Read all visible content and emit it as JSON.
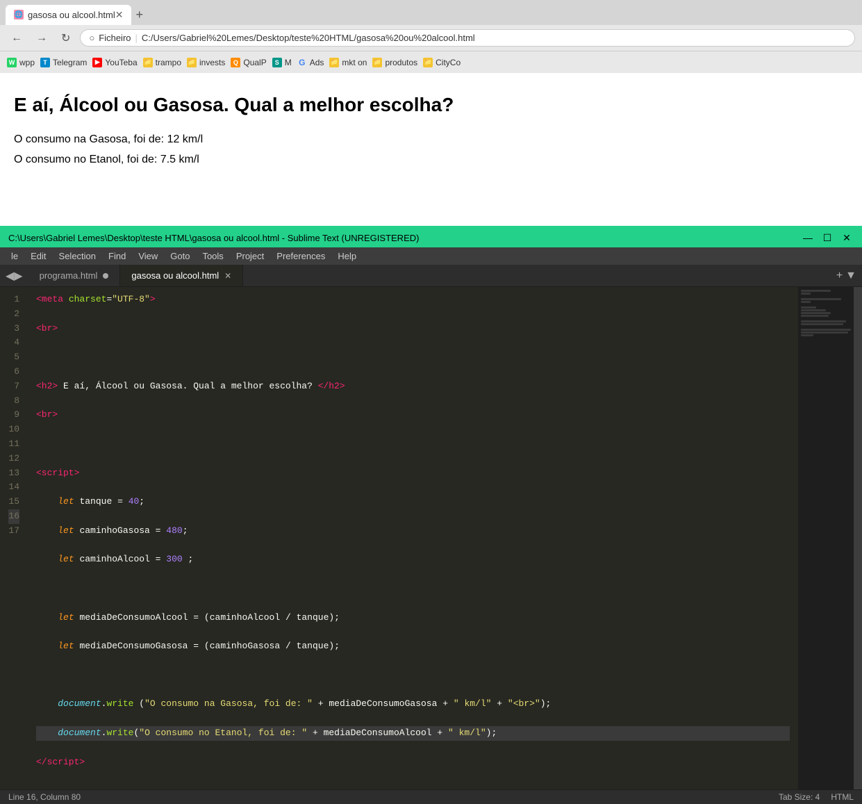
{
  "browser": {
    "tab": {
      "title": "gasosa ou alcool.html",
      "favicon": "🌐"
    },
    "address": {
      "protocol": "Ficheiro",
      "path": "C:/Users/Gabriel%20Lemes/Desktop/teste%20HTML/gasosa%20ou%20alcool.html"
    },
    "bookmarks": [
      {
        "label": "wpp",
        "icon": "W",
        "color": "bk-green"
      },
      {
        "label": "Telegram",
        "icon": "T",
        "color": "bk-blue"
      },
      {
        "label": "YouTeba",
        "icon": "▶",
        "color": "bk-red"
      },
      {
        "label": "trampo",
        "icon": "📁",
        "color": "bk-folder"
      },
      {
        "label": "invests",
        "icon": "📁",
        "color": "bk-folder"
      },
      {
        "label": "QualP",
        "icon": "Q",
        "color": "bk-orange"
      },
      {
        "label": "M",
        "icon": "S",
        "color": "bk-teal"
      },
      {
        "label": "Ads",
        "icon": "G",
        "color": "bk-google"
      },
      {
        "label": "mkt on",
        "icon": "📁",
        "color": "bk-folder"
      },
      {
        "label": "produtos",
        "icon": "📁",
        "color": "bk-folder"
      },
      {
        "label": "CityCo",
        "icon": "📁",
        "color": "bk-folder"
      }
    ]
  },
  "page": {
    "heading": "E aí, Álcool ou Gasosa. Qual a melhor escolha?",
    "output1": "O consumo na Gasosa, foi de: 12 km/l",
    "output2": "O consumo no Etanol, foi de: 7.5 km/l"
  },
  "editor": {
    "titlebar": "C:\\Users\\Gabriel Lemes\\Desktop\\teste HTML\\gasosa ou alcool.html - Sublime Text (UNREGISTERED)",
    "menu": [
      "le",
      "Edit",
      "Selection",
      "Find",
      "View",
      "Goto",
      "Tools",
      "Project",
      "Preferences",
      "Help"
    ],
    "tabs": [
      {
        "label": "programa.html",
        "active": false
      },
      {
        "label": "gasosa ou alcool.html",
        "active": true
      }
    ],
    "statusbar": {
      "position": "Line 16, Column 80",
      "tab_size": "Tab Size: 4",
      "syntax": "HTML"
    }
  }
}
